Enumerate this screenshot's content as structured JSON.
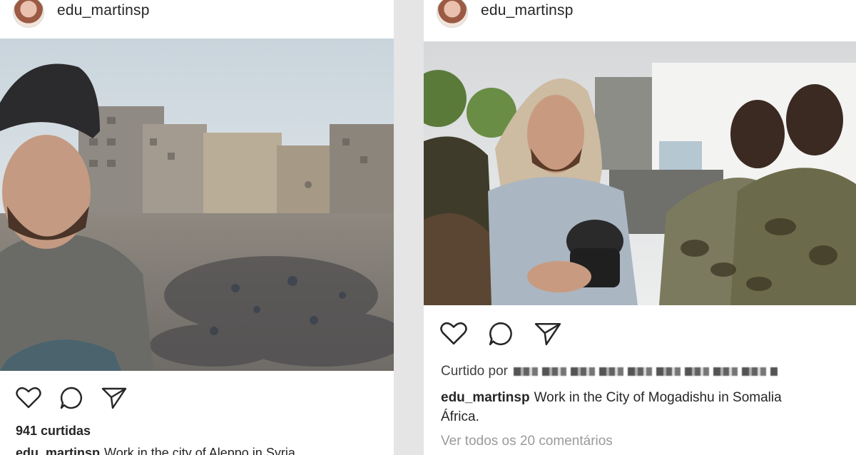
{
  "left_post": {
    "username": "edu_martinsp",
    "likes_text": "941 curtidas",
    "caption_user": "edu_martinsp",
    "caption_text": "Work in the city of Aleppo in Syria"
  },
  "right_post": {
    "username": "edu_martinsp",
    "liked_by_label": "Curtido por",
    "caption_user": "edu_martinsp",
    "caption_line1": "Work in the City of Mogadishu in Somalia",
    "caption_line2": "África.",
    "view_comments": "Ver todos os 20 comentários"
  },
  "icons": {
    "like": "heart-icon",
    "comment": "comment-icon",
    "share": "paper-plane-icon"
  },
  "colors": {
    "text": "#262626",
    "muted": "#9a9a9a",
    "background": "#e4e5e4"
  }
}
